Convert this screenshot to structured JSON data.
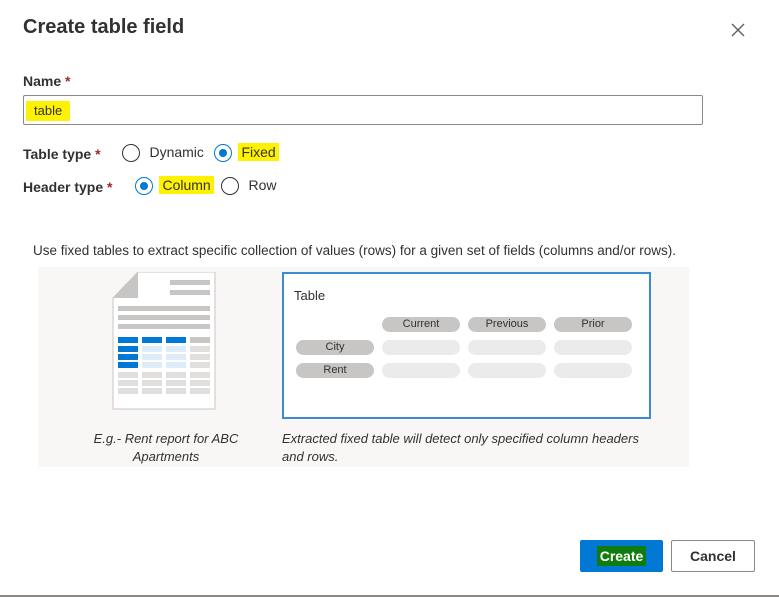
{
  "dialog": {
    "title": "Create table field",
    "name_label": "Name",
    "required_mark": "*",
    "name_value": "table",
    "table_type": {
      "label": "Table type",
      "options": [
        "Dynamic",
        "Fixed"
      ],
      "selected": "Fixed"
    },
    "header_type": {
      "label": "Header type",
      "options": [
        "Column",
        "Row"
      ],
      "selected": "Column"
    },
    "description": "Use fixed tables to extract specific collection of values (rows) for a given set of fields (columns and/or rows).",
    "example": {
      "doc_caption": "E.g.- Rent report for ABC Apartments",
      "table_title": "Table",
      "column_headers": [
        "Current",
        "Previous",
        "Prior"
      ],
      "row_headers": [
        "City",
        "Rent"
      ],
      "table_caption": "Extracted fixed table will detect only specified column headers and rows."
    },
    "buttons": {
      "create": "Create",
      "cancel": "Cancel"
    },
    "colors": {
      "primary": "#0078d4",
      "highlight": "#fff200",
      "create_text_bg": "#107c10"
    }
  }
}
